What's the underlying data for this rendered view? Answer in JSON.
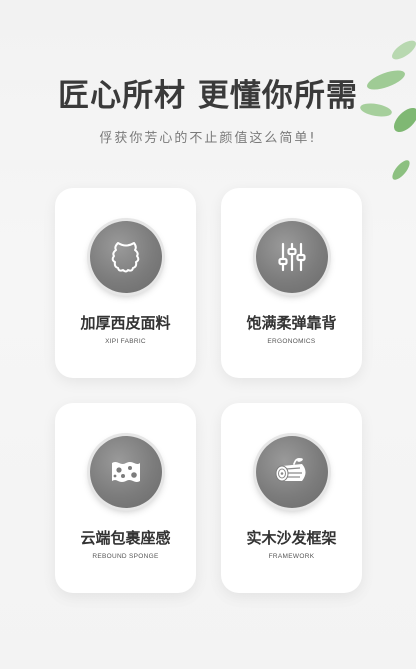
{
  "header": {
    "title": "匠心所材 更懂你所需",
    "subtitle": "俘获你芳心的不止颜值这么简单!"
  },
  "features": [
    {
      "name": "加厚西皮面料",
      "en": "XIPI FABRIC",
      "icon": "leather-icon"
    },
    {
      "name": "饱满柔弹靠背",
      "en": "ERGONOMICS",
      "icon": "sliders-icon"
    },
    {
      "name": "云端包裹座感",
      "en": "REBOUND SPONGE",
      "icon": "sponge-icon"
    },
    {
      "name": "实木沙发框架",
      "en": "FRAMEWORK",
      "icon": "log-icon"
    }
  ]
}
